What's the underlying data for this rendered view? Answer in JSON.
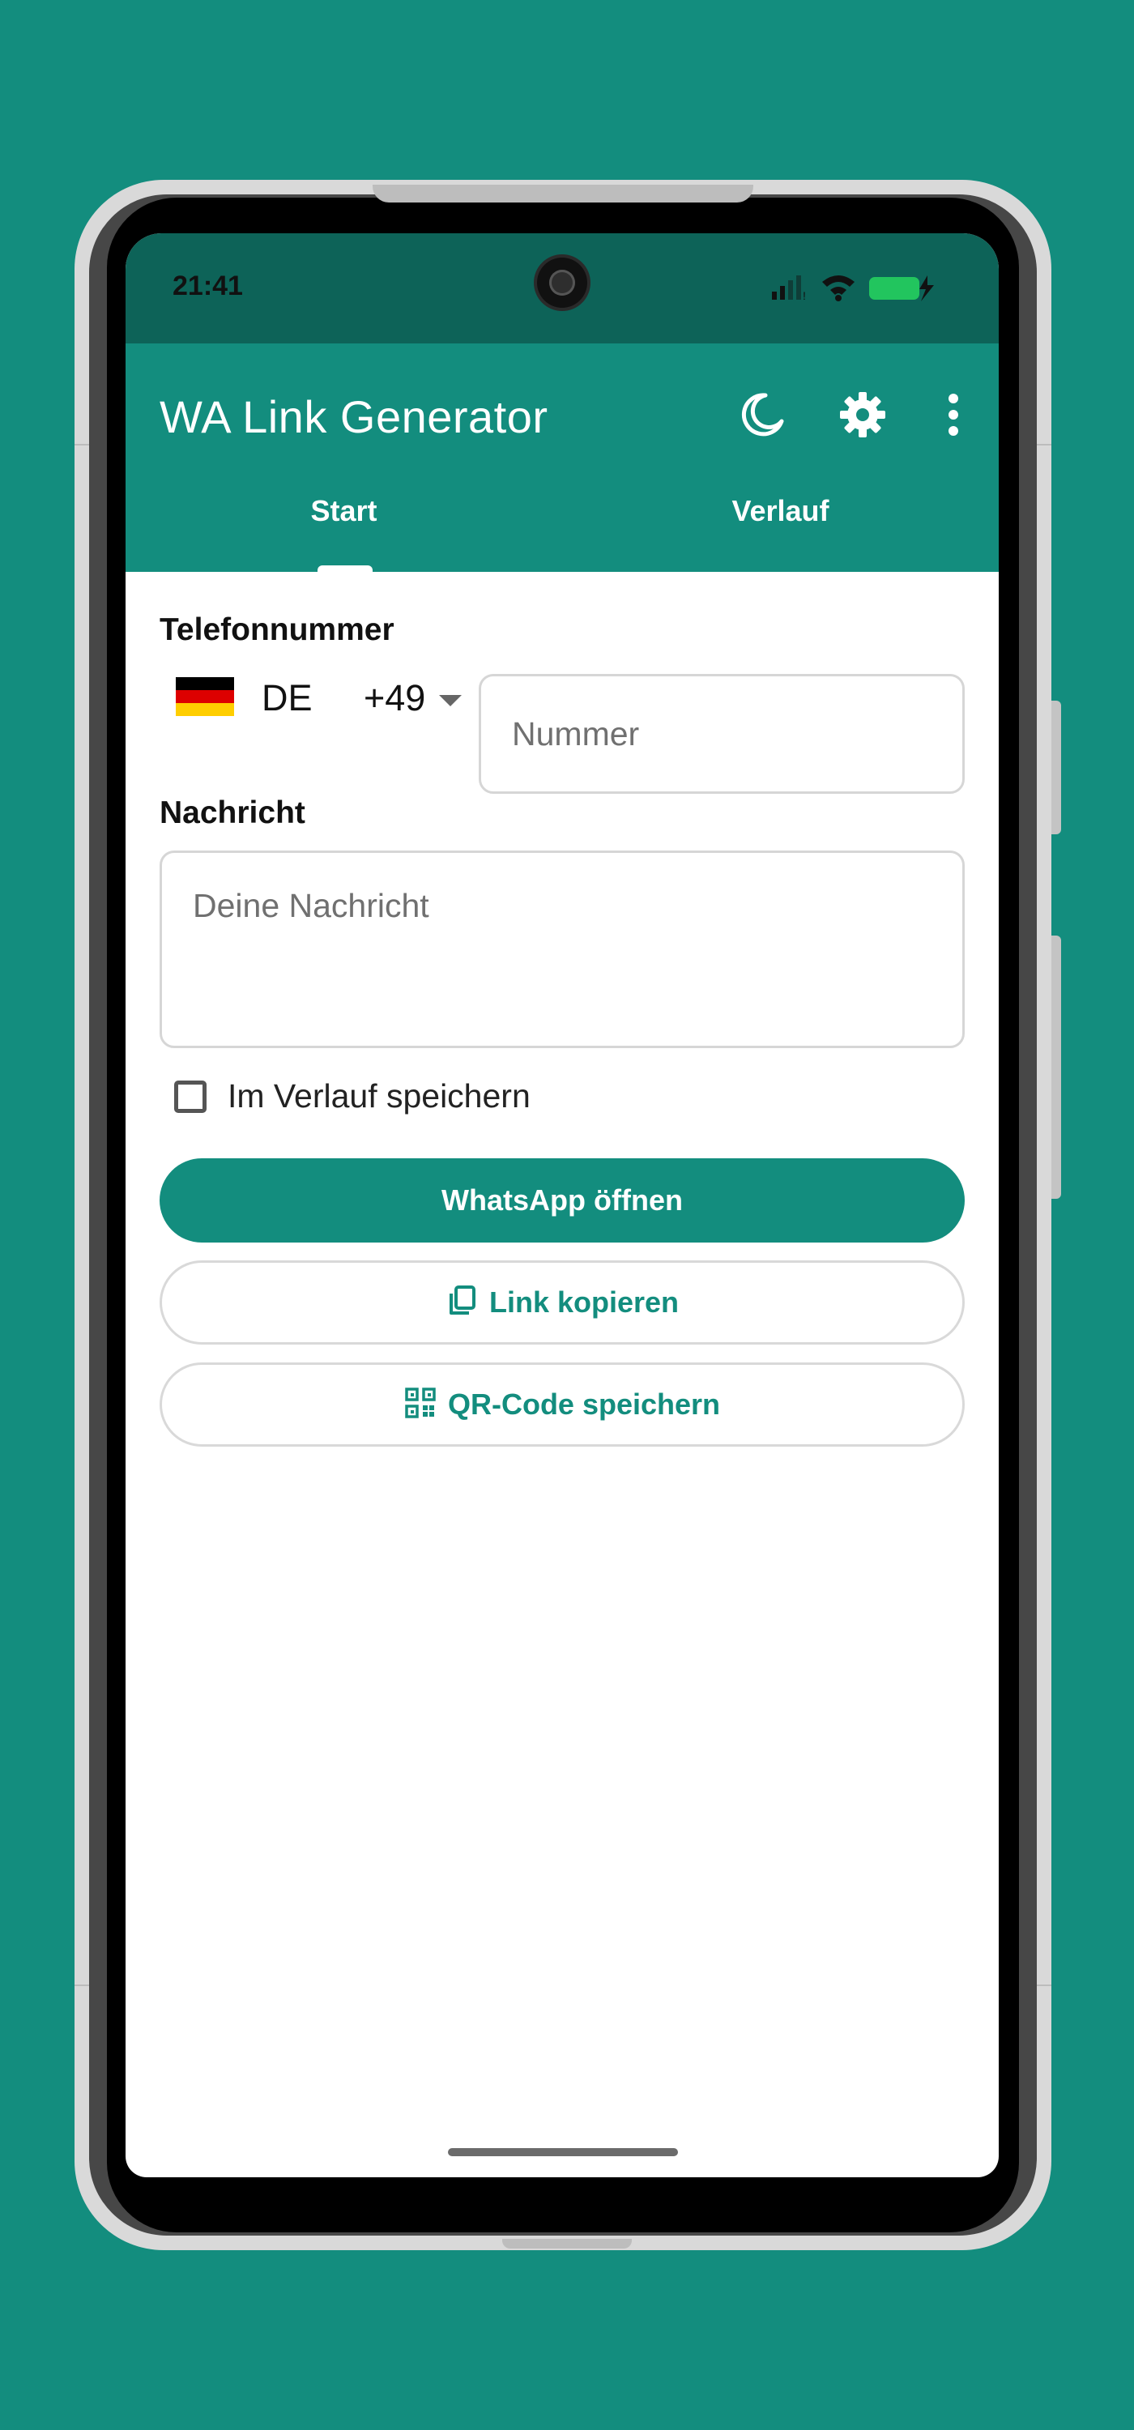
{
  "status_bar": {
    "time": "21:41"
  },
  "app_bar": {
    "title": "WA Link Generator",
    "icons": [
      "moon-icon",
      "gear-icon",
      "more-vert-icon"
    ]
  },
  "tabs": [
    {
      "label": "Start",
      "active": true
    },
    {
      "label": "Verlauf",
      "active": false
    }
  ],
  "form": {
    "phone_label": "Telefonnummer",
    "country": {
      "code": "DE",
      "dial": "+49",
      "flag_colors": [
        "#000000",
        "#dd0000",
        "#ffce00"
      ]
    },
    "number_placeholder": "Nummer",
    "message_label": "Nachricht",
    "message_placeholder": "Deine Nachricht",
    "save_history_label": "Im Verlauf speichern",
    "save_history_checked": false
  },
  "actions": {
    "open_whatsapp_label": "WhatsApp öffnen",
    "copy_link_label": "Link kopieren",
    "save_qr_label": "QR-Code speichern"
  },
  "colors": {
    "primary": "#138d7e",
    "status_bar": "#0d6358",
    "background": "#138d7e"
  }
}
